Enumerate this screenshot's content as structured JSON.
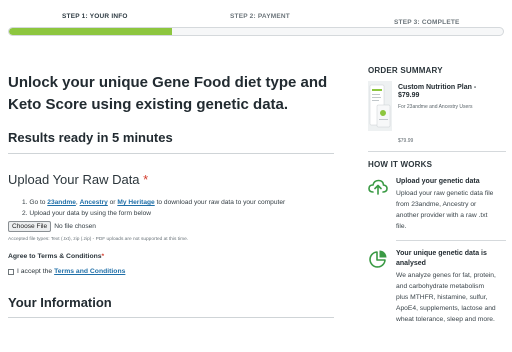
{
  "steps": {
    "items": [
      {
        "label": "STEP 1: YOUR INFO"
      },
      {
        "label": "STEP 2: PAYMENT"
      },
      {
        "label": "STEP 3: COMPLETE"
      }
    ],
    "progress": 0.33,
    "accent_color": "#8dc63f"
  },
  "main": {
    "headline_line1": "Unlock your unique Gene Food diet type and",
    "headline_line2": "Keto Score using existing genetic data.",
    "results": "Results ready in 5 minutes",
    "upload_title": "Upload Your Raw Data",
    "required_mark": "*",
    "instructions": {
      "step1_prefix": "1. Go to ",
      "link_23andme": "23andme",
      "comma": ",",
      "link_ancestry": "Ancestry",
      "or_text": " or ",
      "link_myheritage": "My Heritage",
      "step1_suffix": " to download your raw data to your computer",
      "step2": "2. Upload your data by using the form below"
    },
    "file": {
      "button_label": "Choose File",
      "status": "No file chosen"
    },
    "accepted_types": "Accepted file types: Text (.txt), zip (.zip) - PDF uploads are not supported at this time.",
    "agree_label": "Agree to Terms & Conditions",
    "agree_required": "*",
    "accept_prefix": "I accept the",
    "terms_link": "Terms and Conditions",
    "info_title": "Your Information"
  },
  "sidebar": {
    "order_heading": "ORDER SUMMARY",
    "product_title": "Custom Nutrition Plan -",
    "product_price": "$79.99",
    "product_sub": "For 23andme and Ancestry Users",
    "product_price_small": "$79.99",
    "how_heading": "HOW IT WORKS",
    "how_items": [
      {
        "icon": "cloud-upload-icon",
        "title": "Upload your genetic data",
        "text_lines": [
          "Upload your raw genetic data file",
          "from 23andme, Ancestry or",
          "another provider with a raw .txt",
          "file."
        ]
      },
      {
        "icon": "pie-chart-icon",
        "title_lines": [
          "Your unique genetic data is",
          "analysed"
        ],
        "text_lines": [
          "We analyze genes for fat, protein,",
          "and carbohydrate metabolism",
          "plus MTHFR, histamine, sulfur,",
          "ApoE4, supplements, lactose and",
          "wheat tolerance, sleep and more."
        ]
      }
    ]
  }
}
